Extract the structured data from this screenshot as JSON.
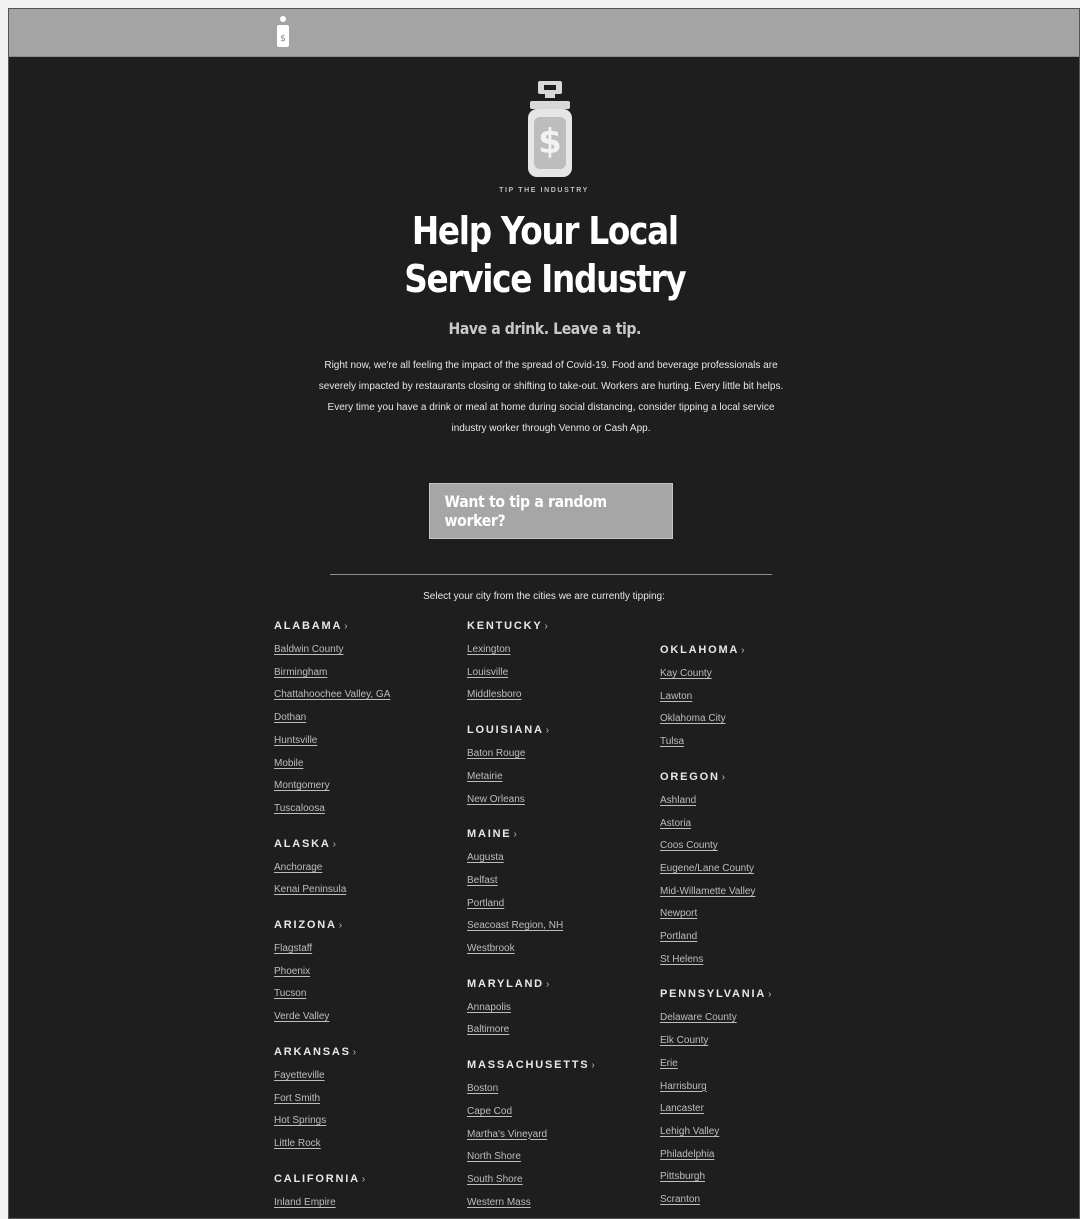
{
  "brand": "TIP THE INDUSTRY",
  "title_line1": "Help Your Local",
  "title_line2": "Service Industry",
  "subtitle": "Have a drink. Leave a tip.",
  "intro": "Right now, we're all feeling the impact of the spread of Covid-19. Food and beverage professionals are severely impacted by restaurants closing or shifting to take-out. Workers are hurting. Every little bit helps. Every time you have a drink or meal at home during social distancing, consider tipping a local service industry worker through Venmo or Cash App.",
  "cta_label": "Want to tip a random worker?",
  "select_note": "Select your city from the cities we are currently tipping:",
  "chevron": "›",
  "columns": [
    [
      {
        "name": "ALABAMA",
        "cities": [
          "Baldwin County",
          "Birmingham",
          "Chattahoochee Valley, GA",
          "Dothan",
          "Huntsville",
          "Mobile",
          "Montgomery",
          "Tuscaloosa"
        ]
      },
      {
        "name": "ALASKA",
        "cities": [
          "Anchorage",
          "Kenai Peninsula"
        ]
      },
      {
        "name": "ARIZONA",
        "cities": [
          "Flagstaff",
          "Phoenix",
          "Tucson",
          "Verde Valley"
        ]
      },
      {
        "name": "ARKANSAS",
        "cities": [
          "Fayetteville",
          "Fort Smith",
          "Hot Springs",
          "Little Rock"
        ]
      },
      {
        "name": "CALIFORNIA",
        "cities": [
          "Inland Empire"
        ]
      }
    ],
    [
      {
        "name": "KENTUCKY",
        "cities": [
          "Lexington",
          "Louisville",
          "Middlesboro"
        ]
      },
      {
        "name": "LOUISIANA",
        "cities": [
          "Baton Rouge",
          "Metairie",
          "New Orleans"
        ]
      },
      {
        "name": "MAINE",
        "cities": [
          "Augusta",
          "Belfast",
          "Portland",
          "Seacoast Region, NH",
          "Westbrook"
        ]
      },
      {
        "name": "MARYLAND",
        "cities": [
          "Annapolis",
          "Baltimore"
        ]
      },
      {
        "name": "MASSACHUSETTS",
        "cities": [
          "Boston",
          "Cape Cod",
          "Martha's Vineyard",
          "North Shore",
          "South Shore",
          "Western Mass"
        ]
      }
    ],
    [
      {
        "name": "OKLAHOMA",
        "cities": [
          "Kay County",
          "Lawton",
          "Oklahoma City",
          "Tulsa"
        ]
      },
      {
        "name": "OREGON",
        "cities": [
          "Ashland",
          "Astoria",
          "Coos County",
          "Eugene/Lane County",
          "Mid-Willamette Valley",
          "Newport",
          "Portland",
          "St Helens"
        ]
      },
      {
        "name": "PENNSYLVANIA",
        "cities": [
          "Delaware County",
          "Elk County",
          "Erie",
          "Harrisburg",
          "Lancaster",
          "Lehigh Valley",
          "Philadelphia",
          "Pittsburgh",
          "Scranton"
        ]
      }
    ]
  ]
}
